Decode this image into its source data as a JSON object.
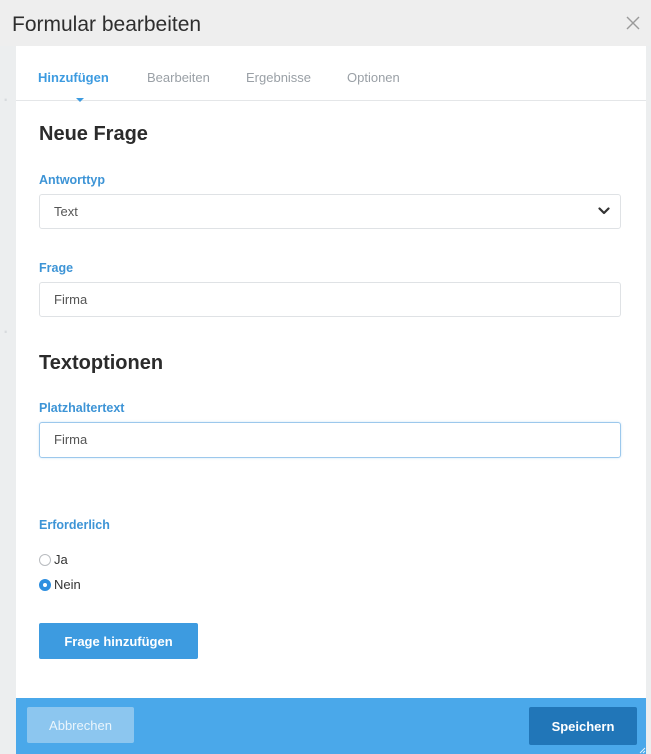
{
  "window": {
    "title": "Formular bearbeiten",
    "close_icon": "close-icon"
  },
  "tabs": [
    {
      "label": "Hinzufügen",
      "active": true
    },
    {
      "label": "Bearbeiten",
      "active": false
    },
    {
      "label": "Ergebnisse",
      "active": false
    },
    {
      "label": "Optionen",
      "active": false
    }
  ],
  "form": {
    "section_new_question": "Neue Frage",
    "answer_type_label": "Antworttyp",
    "answer_type_value": "Text",
    "question_label": "Frage",
    "question_value": "Firma",
    "section_text_options": "Textoptionen",
    "placeholder_label": "Platzhaltertext",
    "placeholder_value": "Firma",
    "required_label": "Erforderlich",
    "required_options": [
      {
        "label": "Ja",
        "selected": false
      },
      {
        "label": "Nein",
        "selected": true
      }
    ],
    "add_question_button": "Frage hinzufügen"
  },
  "footer": {
    "cancel_label": "Abbrechen",
    "save_label": "Speichern"
  },
  "colors": {
    "accent": "#3d9be0",
    "footer_bg": "#4aa8ea",
    "save_bg": "#2176b8"
  }
}
